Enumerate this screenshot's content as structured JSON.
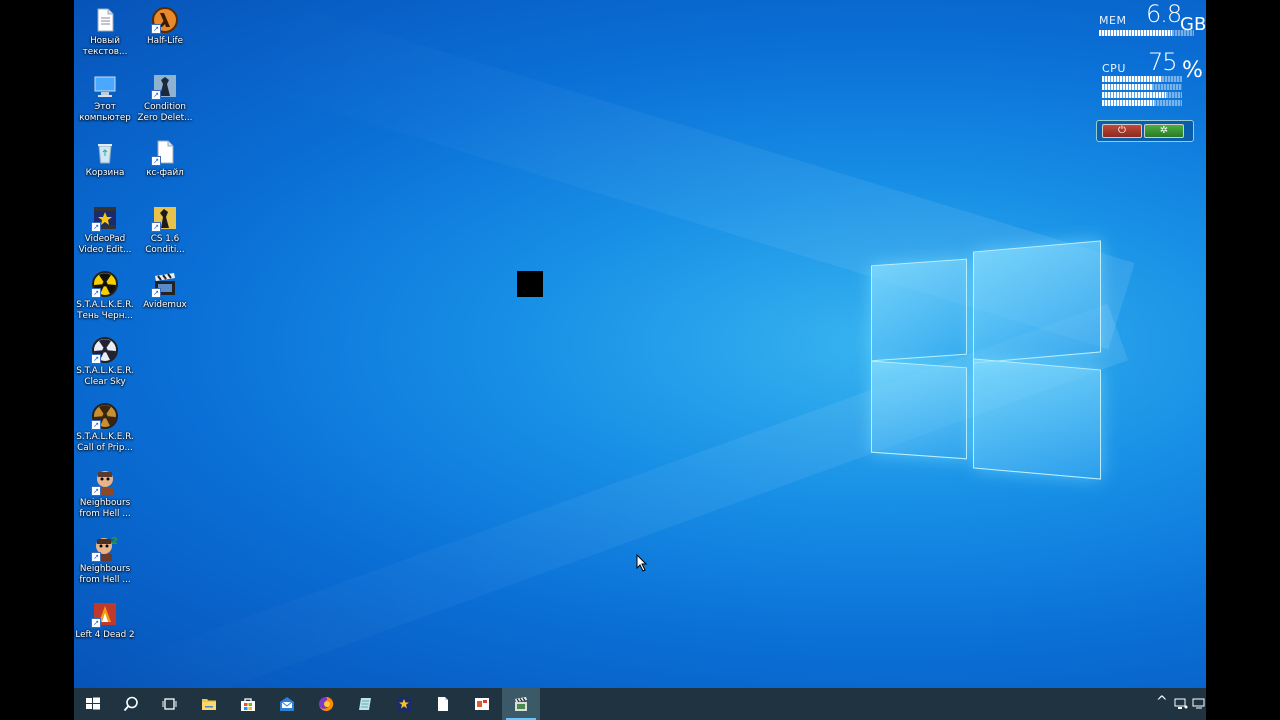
{
  "desktop": {
    "icons": [
      {
        "label": "Новый текстов...",
        "icon": "text-document-icon"
      },
      {
        "label": "Half-Life",
        "icon": "half-life-icon"
      },
      {
        "label": "Этот компьютер",
        "icon": "this-pc-icon"
      },
      {
        "label": "Condition Zero Delet...",
        "icon": "condition-zero-icon"
      },
      {
        "label": "Корзина",
        "icon": "recycle-bin-icon"
      },
      {
        "label": "кс-файл",
        "icon": "blank-file-icon"
      },
      {
        "label": "VideoPad Video Edit...",
        "icon": "videopad-icon"
      },
      {
        "label": "CS 1.6 Conditi...",
        "icon": "counter-strike-icon"
      },
      {
        "label": "S.T.A.L.K.E.R. Тень Черн...",
        "icon": "stalker-radiation-icon"
      },
      {
        "label": "Avidemux",
        "icon": "avidemux-clapperboard-icon"
      },
      {
        "label": "S.T.A.L.K.E.R. Clear Sky",
        "icon": "stalker-clear-sky-icon"
      },
      {
        "label": "S.T.A.L.K.E.R. Call of Prip...",
        "icon": "stalker-call-of-pripyat-icon"
      },
      {
        "label": "Neighbours from Hell ...",
        "icon": "neighbours-from-hell-icon"
      },
      {
        "label": "Neighbours from Hell ...",
        "icon": "neighbours-from-hell-2-icon"
      },
      {
        "label": "Left 4 Dead 2",
        "icon": "left4dead2-icon"
      }
    ]
  },
  "gadget": {
    "mem_label": "MEM",
    "mem_value": "6.8",
    "mem_unit": "GB",
    "cpu_label": "CPU",
    "cpu_value": "75",
    "cpu_unit": "%",
    "power_symbol": "⏻",
    "settings_symbol": "✲"
  },
  "taskbar": {
    "items": [
      {
        "name": "start-button",
        "icon": "windows-logo-icon"
      },
      {
        "name": "search-button",
        "icon": "search-icon"
      },
      {
        "name": "task-view-button",
        "icon": "task-view-icon"
      },
      {
        "name": "taskbar-explorer",
        "icon": "folder-icon"
      },
      {
        "name": "taskbar-store",
        "icon": "store-bag-icon"
      },
      {
        "name": "taskbar-mail",
        "icon": "mail-icon"
      },
      {
        "name": "taskbar-firefox",
        "icon": "firefox-icon"
      },
      {
        "name": "taskbar-notepad",
        "icon": "notepad-icon"
      },
      {
        "name": "taskbar-videopad",
        "icon": "videopad-icon"
      },
      {
        "name": "taskbar-file",
        "icon": "blank-file-icon"
      },
      {
        "name": "taskbar-office",
        "icon": "office-icon"
      },
      {
        "name": "taskbar-avidemux",
        "icon": "avidemux-clapperboard-icon"
      }
    ],
    "tray": {
      "chevron": "^"
    }
  },
  "colors": {
    "accent": "#64c8ff",
    "taskbar": "#1f3340",
    "wallpaper": "#0a6fd6"
  }
}
